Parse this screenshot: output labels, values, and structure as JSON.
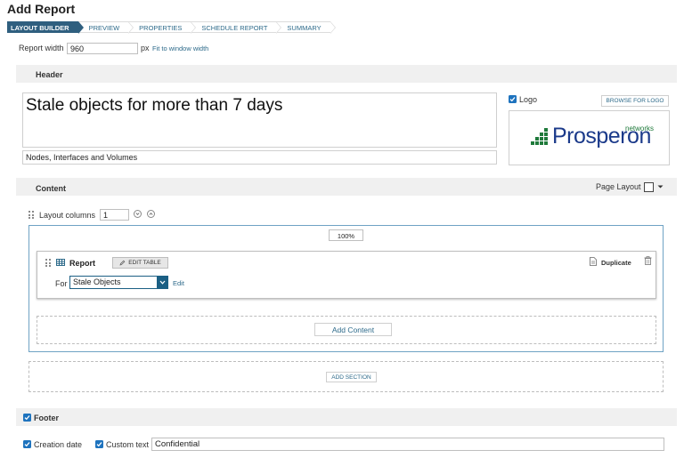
{
  "page": {
    "title": "Add Report"
  },
  "steps": [
    {
      "label": "Layout Builder",
      "active": true
    },
    {
      "label": "Preview",
      "active": false
    },
    {
      "label": "Properties",
      "active": false
    },
    {
      "label": "Schedule Report",
      "active": false
    },
    {
      "label": "Summary",
      "active": false
    }
  ],
  "report_width": {
    "label": "Report width",
    "value": "960",
    "unit": "px",
    "fit_link": "Fit to window width"
  },
  "header": {
    "section_title": "Header",
    "title": "Stale objects for more than 7 days",
    "subtitle": "Nodes, Interfaces and Volumes",
    "logo_label": "Logo",
    "logo_checked": true,
    "browse_button": "Browse for logo",
    "logo_text": "Prosperon",
    "logo_tagline": "networks",
    "logo_color": "#1f7a3b"
  },
  "content": {
    "section_title": "Content",
    "page_layout_label": "Page Layout",
    "layout_columns_label": "Layout columns",
    "layout_columns_value": "1",
    "column_width": "100%",
    "report_label": "Report",
    "edit_table_button": "Edit Table",
    "duplicate_label": "Duplicate",
    "for_label": "For",
    "for_value": "Stale Objects",
    "edit_link": "Edit",
    "add_content_button": "Add Content",
    "add_section_button": "Add Section"
  },
  "footer": {
    "section_title": "Footer",
    "footer_checked": true,
    "creation_date_label": "Creation date",
    "creation_date_checked": true,
    "custom_text_label": "Custom text",
    "custom_text_checked": true,
    "custom_text_value": "Confidential"
  },
  "colors": {
    "accent": "#2f5f7f",
    "link": "#2d6a8a",
    "checkbox": "#1e73be"
  }
}
